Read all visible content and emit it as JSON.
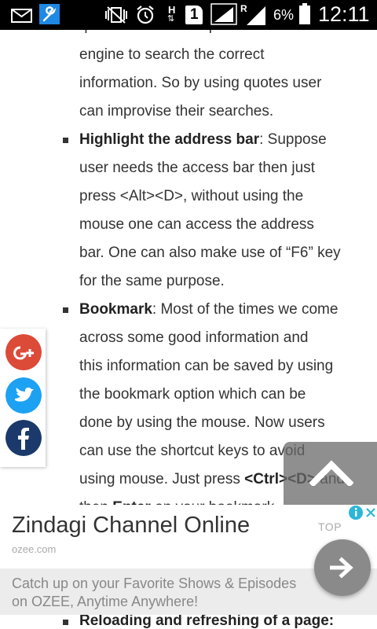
{
  "status_bar": {
    "battery_percent": "6%",
    "time": "12:11",
    "network_label": "H",
    "sim_slot": "1",
    "roaming_label": "R",
    "icons": [
      "mail-icon",
      "wrench-icon",
      "no-vibrate-icon",
      "alarm-icon",
      "network-h-icon",
      "sim-1-icon",
      "signal-icon",
      "roaming-signal-icon",
      "battery-icon"
    ]
  },
  "article": {
    "lines": [
      "quotes then this helps the search",
      "engine to search the correct",
      "information. So by using quotes user",
      "can improvise their searches.",
      "Highlight the address bar",
      ": Suppose",
      "user needs the access bar then just",
      "press <Alt><D>, without using the",
      "mouse one can access the address",
      "bar. One can also make use of “F6” key",
      "for the same purpose.",
      "Bookmark",
      ": Most of the times we come",
      "across some good information and",
      "this information can be saved by using",
      "the bookmark option which can be",
      "done by using the mouse.  Now users",
      "can use the shortcut keys to avoid",
      "using mouse. Just press ",
      "<Ctrl><D>",
      " and",
      "then ",
      "Enter",
      " on your bookmark",
      "Reloading and refreshing of a page",
      ":"
    ]
  },
  "share": {
    "items": [
      {
        "name": "google-plus",
        "color": "#dc4a38"
      },
      {
        "name": "twitter",
        "color": "#1da1f2"
      },
      {
        "name": "facebook",
        "color": "#1b3a6b"
      }
    ]
  },
  "ad": {
    "title": "Zindagi Channel Online",
    "domain": "ozee.com",
    "top_label": "TOP",
    "description": "Catch up on your Favorite Shows & Episodes on OZEE, Anytime Anywhere!"
  },
  "colors": {
    "accent_blue": "#1e88e5",
    "text": "#333333",
    "ad_grey": "#ececec"
  }
}
